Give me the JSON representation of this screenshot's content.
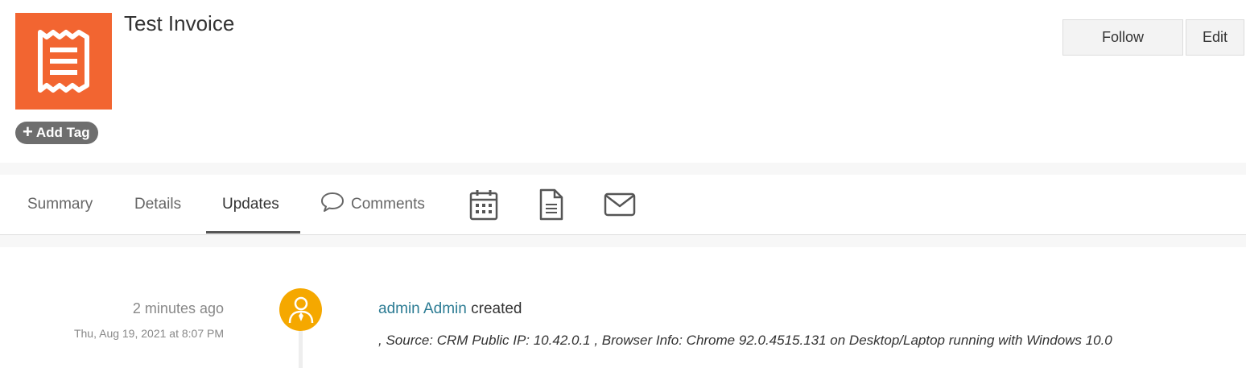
{
  "record": {
    "title": "Test Invoice",
    "icon": "receipt-icon",
    "icon_color": "#f26531",
    "add_tag_label": "Add Tag"
  },
  "actions": {
    "follow_label": "Follow",
    "edit_label": "Edit"
  },
  "tabs": [
    {
      "label": "Summary",
      "active": false
    },
    {
      "label": "Details",
      "active": false
    },
    {
      "label": "Updates",
      "active": true
    },
    {
      "label": "Comments",
      "icon": "comment-icon",
      "active": false
    },
    {
      "label": "",
      "icon": "calendar-icon",
      "active": false
    },
    {
      "label": "",
      "icon": "document-icon",
      "active": false
    },
    {
      "label": "",
      "icon": "envelope-icon",
      "active": false
    }
  ],
  "updates": [
    {
      "relative_time": "2 minutes ago",
      "absolute_time": "Thu, Aug 19, 2021 at 8:07 PM",
      "avatar_color": "#f5a800",
      "user": "admin Admin",
      "action": "created",
      "detail": ", Source: CRM Public IP: 10.42.0.1 , Browser Info: Chrome 92.0.4515.131 on Desktop/Laptop running with Windows 10.0"
    }
  ]
}
